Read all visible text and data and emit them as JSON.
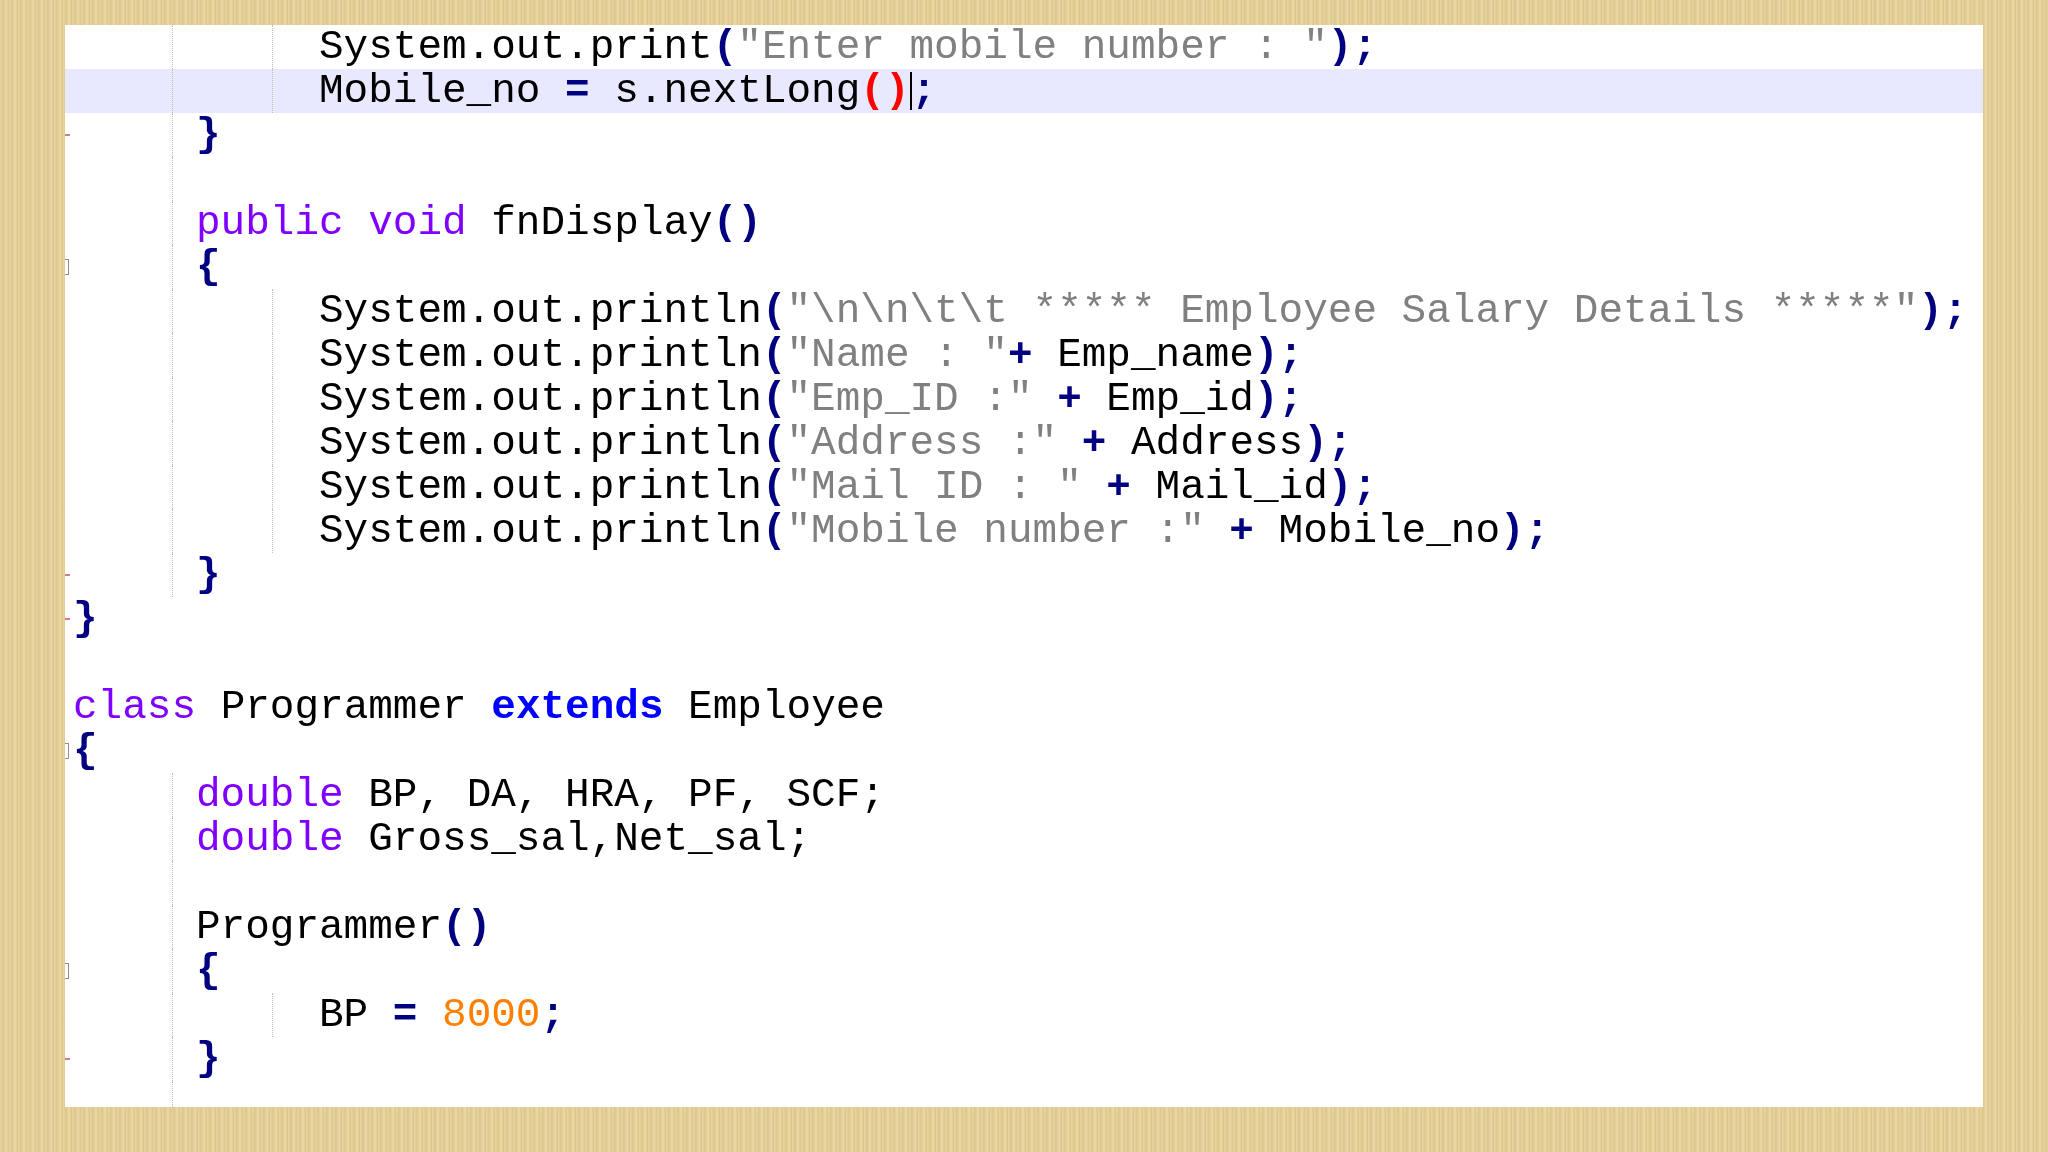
{
  "editor": {
    "lines": [
      {
        "kind": "statement",
        "highlighted": false,
        "fold_start": false,
        "fold_end": false,
        "tokens": [
          {
            "kind": "plain",
            "text": "System.out.print"
          },
          {
            "kind": "op",
            "text": "("
          },
          {
            "kind": "string",
            "text": "\"Enter mobile number : \""
          },
          {
            "kind": "op",
            "text": ");"
          }
        ]
      },
      {
        "kind": "statement",
        "highlighted": true,
        "fold_start": false,
        "fold_end": false,
        "tokens": [
          {
            "kind": "plain",
            "text": "Mobile_no "
          },
          {
            "kind": "op",
            "text": "="
          },
          {
            "kind": "plain",
            "text": " s.nextLong"
          },
          {
            "kind": "match",
            "text": "()"
          },
          {
            "kind": "caret"
          },
          {
            "kind": "op",
            "text": ";"
          }
        ]
      },
      {
        "kind": "member",
        "highlighted": false,
        "fold_start": false,
        "fold_end": true,
        "tokens": [
          {
            "kind": "op",
            "text": "}"
          }
        ]
      },
      {
        "kind": "blank",
        "highlighted": false,
        "fold_start": false,
        "fold_end": false
      },
      {
        "kind": "member",
        "highlighted": false,
        "fold_start": false,
        "fold_end": false,
        "tokens": [
          {
            "kind": "keyword",
            "text": "public void"
          },
          {
            "kind": "plain",
            "text": " fnDisplay"
          },
          {
            "kind": "op",
            "text": "()"
          }
        ]
      },
      {
        "kind": "member",
        "highlighted": false,
        "fold_start": true,
        "fold_end": false,
        "tokens": [
          {
            "kind": "op",
            "text": "{"
          }
        ]
      },
      {
        "kind": "statement",
        "highlighted": false,
        "fold_start": false,
        "fold_end": false,
        "tokens": [
          {
            "kind": "plain",
            "text": "System.out.println"
          },
          {
            "kind": "op",
            "text": "("
          },
          {
            "kind": "string",
            "text": "\"\\n\\n\\t\\t ***** Employee Salary Details *****\""
          },
          {
            "kind": "op",
            "text": ");"
          }
        ]
      },
      {
        "kind": "statement",
        "highlighted": false,
        "fold_start": false,
        "fold_end": false,
        "tokens": [
          {
            "kind": "plain",
            "text": "System.out.println"
          },
          {
            "kind": "op",
            "text": "("
          },
          {
            "kind": "string",
            "text": "\"Name : \""
          },
          {
            "kind": "op",
            "text": "+"
          },
          {
            "kind": "plain",
            "text": " Emp_name"
          },
          {
            "kind": "op",
            "text": ");"
          }
        ]
      },
      {
        "kind": "statement",
        "highlighted": false,
        "fold_start": false,
        "fold_end": false,
        "tokens": [
          {
            "kind": "plain",
            "text": "System.out.println"
          },
          {
            "kind": "op",
            "text": "("
          },
          {
            "kind": "string",
            "text": "\"Emp_ID :\""
          },
          {
            "kind": "op",
            "text": " +"
          },
          {
            "kind": "plain",
            "text": " Emp_id"
          },
          {
            "kind": "op",
            "text": ");"
          }
        ]
      },
      {
        "kind": "statement",
        "highlighted": false,
        "fold_start": false,
        "fold_end": false,
        "tokens": [
          {
            "kind": "plain",
            "text": "System.out.println"
          },
          {
            "kind": "op",
            "text": "("
          },
          {
            "kind": "string",
            "text": "\"Address :\""
          },
          {
            "kind": "op",
            "text": " +"
          },
          {
            "kind": "plain",
            "text": " Address"
          },
          {
            "kind": "op",
            "text": ");"
          }
        ]
      },
      {
        "kind": "statement",
        "highlighted": false,
        "fold_start": false,
        "fold_end": false,
        "tokens": [
          {
            "kind": "plain",
            "text": "System.out.println"
          },
          {
            "kind": "op",
            "text": "("
          },
          {
            "kind": "string",
            "text": "\"Mail ID : \""
          },
          {
            "kind": "op",
            "text": " +"
          },
          {
            "kind": "plain",
            "text": " Mail_id"
          },
          {
            "kind": "op",
            "text": ");"
          }
        ]
      },
      {
        "kind": "statement",
        "highlighted": false,
        "fold_start": false,
        "fold_end": false,
        "tokens": [
          {
            "kind": "plain",
            "text": "System.out.println"
          },
          {
            "kind": "op",
            "text": "("
          },
          {
            "kind": "string",
            "text": "\"Mobile number :\""
          },
          {
            "kind": "op",
            "text": " +"
          },
          {
            "kind": "plain",
            "text": " Mobile_no"
          },
          {
            "kind": "op",
            "text": ");"
          }
        ]
      },
      {
        "kind": "member",
        "highlighted": false,
        "fold_start": false,
        "fold_end": true,
        "tokens": [
          {
            "kind": "op",
            "text": "}"
          }
        ]
      },
      {
        "kind": "outer",
        "highlighted": false,
        "fold_start": false,
        "fold_end": true,
        "tokens": [
          {
            "kind": "op",
            "text": "}"
          }
        ]
      },
      {
        "kind": "blank",
        "highlighted": false,
        "fold_start": false,
        "fold_end": false
      },
      {
        "kind": "outer",
        "highlighted": false,
        "fold_start": false,
        "fold_end": false,
        "tokens": [
          {
            "kind": "keyword",
            "text": "class"
          },
          {
            "kind": "plain",
            "text": " Programmer "
          },
          {
            "kind": "keyword2",
            "text": "extends"
          },
          {
            "kind": "plain",
            "text": " Employee"
          }
        ]
      },
      {
        "kind": "outer",
        "highlighted": false,
        "fold_start": true,
        "fold_end": false,
        "tokens": [
          {
            "kind": "op",
            "text": "{"
          }
        ]
      },
      {
        "kind": "member",
        "highlighted": false,
        "fold_start": false,
        "fold_end": false,
        "tokens": [
          {
            "kind": "keyword",
            "text": "double"
          },
          {
            "kind": "plain",
            "text": " BP, DA, HRA, PF, SCF;"
          }
        ]
      },
      {
        "kind": "member",
        "highlighted": false,
        "fold_start": false,
        "fold_end": false,
        "tokens": [
          {
            "kind": "keyword",
            "text": "double"
          },
          {
            "kind": "plain",
            "text": " Gross_sal,Net_sal;"
          }
        ]
      },
      {
        "kind": "blank",
        "highlighted": false,
        "fold_start": false,
        "fold_end": false
      },
      {
        "kind": "member",
        "highlighted": false,
        "fold_start": false,
        "fold_end": false,
        "tokens": [
          {
            "kind": "plain",
            "text": "Programmer"
          },
          {
            "kind": "op",
            "text": "()"
          }
        ]
      },
      {
        "kind": "member",
        "highlighted": false,
        "fold_start": true,
        "fold_end": false,
        "tokens": [
          {
            "kind": "op",
            "text": "{"
          }
        ]
      },
      {
        "kind": "statement",
        "highlighted": false,
        "fold_start": false,
        "fold_end": false,
        "tokens": [
          {
            "kind": "plain",
            "text": "BP "
          },
          {
            "kind": "op",
            "text": "="
          },
          {
            "kind": "number",
            "text": " 8000"
          },
          {
            "kind": "op",
            "text": ";"
          }
        ]
      },
      {
        "kind": "member",
        "highlighted": false,
        "fold_start": false,
        "fold_end": true,
        "tokens": [
          {
            "kind": "op",
            "text": "}"
          }
        ]
      }
    ]
  }
}
